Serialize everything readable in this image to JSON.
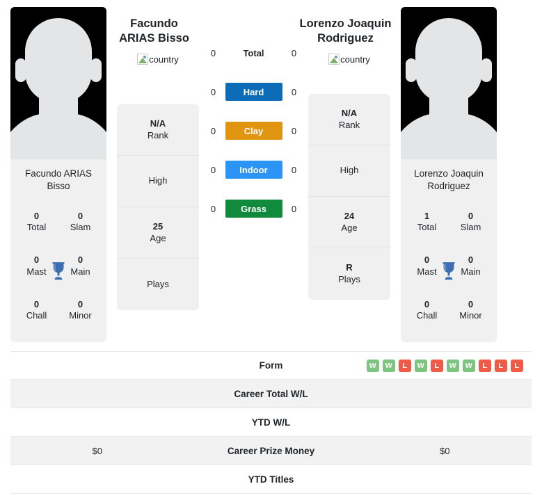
{
  "players": {
    "left": {
      "name_line1": "Facundo",
      "name_line2": "ARIAS Bisso",
      "photo_caption": "Facundo ARIAS Bisso",
      "country_alt": "country",
      "titles": {
        "total_val": "0",
        "total_lbl": "Total",
        "slam_val": "0",
        "slam_lbl": "Slam",
        "mast_val": "0",
        "mast_lbl": "Mast",
        "main_val": "0",
        "main_lbl": "Main",
        "chall_val": "0",
        "chall_lbl": "Chall",
        "minor_val": "0",
        "minor_lbl": "Minor"
      },
      "info": {
        "rank_val": "N/A",
        "rank_lbl": "Rank",
        "high_val": "",
        "high_lbl": "High",
        "age_val": "25",
        "age_lbl": "Age",
        "plays_val": "",
        "plays_lbl": "Plays"
      },
      "table": {
        "form": "",
        "career_wl": "",
        "ytd_wl": "",
        "prize": "$0",
        "ytd_titles": ""
      }
    },
    "right": {
      "name_line1": "Lorenzo Joaquin",
      "name_line2": "Rodriguez",
      "photo_caption_line1": "Lorenzo Joaquin",
      "photo_caption_line2": "Rodriguez",
      "country_alt": "country",
      "titles": {
        "total_val": "1",
        "total_lbl": "Total",
        "slam_val": "0",
        "slam_lbl": "Slam",
        "mast_val": "0",
        "mast_lbl": "Mast",
        "main_val": "0",
        "main_lbl": "Main",
        "chall_val": "0",
        "chall_lbl": "Chall",
        "minor_val": "0",
        "minor_lbl": "Minor"
      },
      "info": {
        "rank_val": "N/A",
        "rank_lbl": "Rank",
        "high_val": "",
        "high_lbl": "High",
        "age_val": "24",
        "age_lbl": "Age",
        "plays_val": "R",
        "plays_lbl": "Plays"
      },
      "table": {
        "career_wl": "",
        "ytd_wl": "",
        "prize": "$0",
        "ytd_titles": ""
      }
    }
  },
  "surfaces": [
    {
      "key": "total",
      "label": "Total",
      "left": "0",
      "right": "0",
      "color": "transparent",
      "text_color": "#212529"
    },
    {
      "key": "hard",
      "label": "Hard",
      "left": "0",
      "right": "0",
      "color": "#0d6cb8",
      "text_color": "#ffffff"
    },
    {
      "key": "clay",
      "label": "Clay",
      "left": "0",
      "right": "0",
      "color": "#e09410",
      "text_color": "#ffffff"
    },
    {
      "key": "indoor",
      "label": "Indoor",
      "left": "0",
      "right": "0",
      "color": "#2b94f5",
      "text_color": "#ffffff"
    },
    {
      "key": "grass",
      "label": "Grass",
      "left": "0",
      "right": "0",
      "color": "#118a3d",
      "text_color": "#ffffff"
    }
  ],
  "table_rows": [
    {
      "key": "form",
      "label": "Form",
      "left": "",
      "right": ""
    },
    {
      "key": "career_wl",
      "label": "Career Total W/L",
      "left": "",
      "right": ""
    },
    {
      "key": "ytd_wl",
      "label": "YTD W/L",
      "left": "",
      "right": ""
    },
    {
      "key": "prize",
      "label": "Career Prize Money",
      "left": "$0",
      "right": "$0"
    },
    {
      "key": "ytd_titles",
      "label": "YTD Titles",
      "left": "",
      "right": ""
    }
  ],
  "form_badges": [
    {
      "result": "W"
    },
    {
      "result": "W"
    },
    {
      "result": "L"
    },
    {
      "result": "W"
    },
    {
      "result": "L"
    },
    {
      "result": "W"
    },
    {
      "result": "W"
    },
    {
      "result": "L"
    },
    {
      "result": "L"
    },
    {
      "result": "L"
    }
  ],
  "colors": {
    "win": "#7ec481",
    "loss": "#ef5b46",
    "trophy": "#3d6eb0",
    "card_bg": "#f0f0f0",
    "row_alt": "#f2f2f2"
  }
}
